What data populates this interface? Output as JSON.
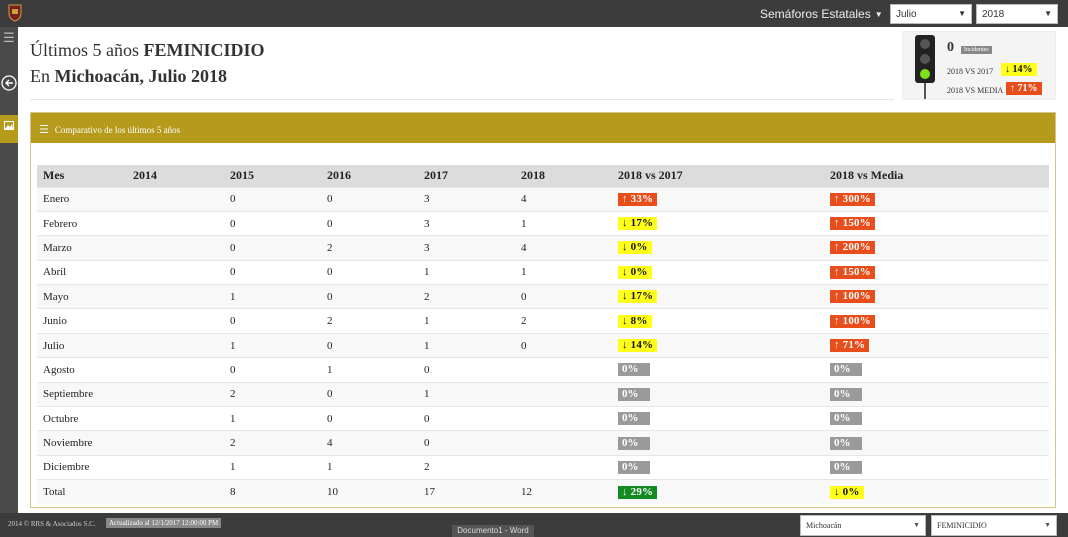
{
  "topbar": {
    "semaforos_label": "Semáforos Estatales",
    "month_select": "Julio",
    "year_select": "2018"
  },
  "header": {
    "line1_prefix": "Últimos 5 años ",
    "line1_bold": "FEMINICIDIO",
    "line2_prefix": "En ",
    "line2_bold": "Michoacán, Julio 2018"
  },
  "indicator": {
    "count": "0",
    "count_tag": "Incidentes",
    "row1_label": "2018 VS 2017",
    "row1_badge": "↓ 14%",
    "row2_label": "2018 VS MEDIA",
    "row2_badge": "↑ 71%"
  },
  "panel": {
    "title": "Comparativo de los últimos 5 años"
  },
  "table": {
    "headers": [
      "Mes",
      "2014",
      "2015",
      "2016",
      "2017",
      "2018",
      "2018 vs 2017",
      "2018 vs Media"
    ],
    "rows": [
      {
        "mes": "Enero",
        "y2014": "",
        "y2015": "0",
        "y2016": "0",
        "y2017": "3",
        "y2018": "4",
        "vs2017": "↑ 33%",
        "vs2017_kind": "up",
        "vsMedia": "↑ 300%",
        "vsMedia_kind": "up"
      },
      {
        "mes": "Febrero",
        "y2014": "",
        "y2015": "0",
        "y2016": "0",
        "y2017": "3",
        "y2018": "1",
        "vs2017": "↓ 17%",
        "vs2017_kind": "down",
        "vsMedia": "↑ 150%",
        "vsMedia_kind": "up"
      },
      {
        "mes": "Marzo",
        "y2014": "",
        "y2015": "0",
        "y2016": "2",
        "y2017": "3",
        "y2018": "4",
        "vs2017": "↓  0%",
        "vs2017_kind": "down",
        "vsMedia": "↑ 200%",
        "vsMedia_kind": "up"
      },
      {
        "mes": "Abril",
        "y2014": "",
        "y2015": "0",
        "y2016": "0",
        "y2017": "1",
        "y2018": "1",
        "vs2017": "↓  0%",
        "vs2017_kind": "down",
        "vsMedia": "↑ 150%",
        "vsMedia_kind": "up"
      },
      {
        "mes": "Mayo",
        "y2014": "",
        "y2015": "1",
        "y2016": "0",
        "y2017": "2",
        "y2018": "0",
        "vs2017": "↓ 17%",
        "vs2017_kind": "down",
        "vsMedia": "↑ 100%",
        "vsMedia_kind": "up"
      },
      {
        "mes": "Junio",
        "y2014": "",
        "y2015": "0",
        "y2016": "2",
        "y2017": "1",
        "y2018": "2",
        "vs2017": "↓  8%",
        "vs2017_kind": "down",
        "vsMedia": "↑ 100%",
        "vsMedia_kind": "up"
      },
      {
        "mes": "Julio",
        "y2014": "",
        "y2015": "1",
        "y2016": "0",
        "y2017": "1",
        "y2018": "0",
        "vs2017": "↓ 14%",
        "vs2017_kind": "down",
        "vsMedia": "↑ 71%",
        "vsMedia_kind": "up"
      },
      {
        "mes": "Agosto",
        "y2014": "",
        "y2015": "0",
        "y2016": "1",
        "y2017": "0",
        "y2018": "",
        "vs2017": "0%",
        "vs2017_kind": "zero",
        "vsMedia": "0%",
        "vsMedia_kind": "zero"
      },
      {
        "mes": "Septiembre",
        "y2014": "",
        "y2015": "2",
        "y2016": "0",
        "y2017": "1",
        "y2018": "",
        "vs2017": "0%",
        "vs2017_kind": "zero",
        "vsMedia": "0%",
        "vsMedia_kind": "zero"
      },
      {
        "mes": "Octubre",
        "y2014": "",
        "y2015": "1",
        "y2016": "0",
        "y2017": "0",
        "y2018": "",
        "vs2017": "0%",
        "vs2017_kind": "zero",
        "vsMedia": "0%",
        "vsMedia_kind": "zero"
      },
      {
        "mes": "Noviembre",
        "y2014": "",
        "y2015": "2",
        "y2016": "4",
        "y2017": "0",
        "y2018": "",
        "vs2017": "0%",
        "vs2017_kind": "zero",
        "vsMedia": "0%",
        "vsMedia_kind": "zero"
      },
      {
        "mes": "Diciembre",
        "y2014": "",
        "y2015": "1",
        "y2016": "1",
        "y2017": "2",
        "y2018": "",
        "vs2017": "0%",
        "vs2017_kind": "zero",
        "vsMedia": "0%",
        "vsMedia_kind": "zero"
      },
      {
        "mes": "Total",
        "y2014": "",
        "y2015": "8",
        "y2016": "10",
        "y2017": "17",
        "y2018": "12",
        "vs2017": "↓ 29%",
        "vs2017_kind": "green",
        "vsMedia": "↓  0%",
        "vsMedia_kind": "down"
      }
    ]
  },
  "footer": {
    "copyright": "2014 © RRS & Asociados S.C.",
    "updated": "Actualizado al 12/1/2017 12:00:00 PM",
    "taskbar_word": "Documento1 - Word",
    "state_select": "Michoacán",
    "crime_select": "FEMINICIDIO"
  },
  "colors": {
    "gold": "#b59a1c",
    "up": "#e84e1b",
    "down": "#ffff1a",
    "zero": "#9a9a9a",
    "green": "#138a22"
  }
}
